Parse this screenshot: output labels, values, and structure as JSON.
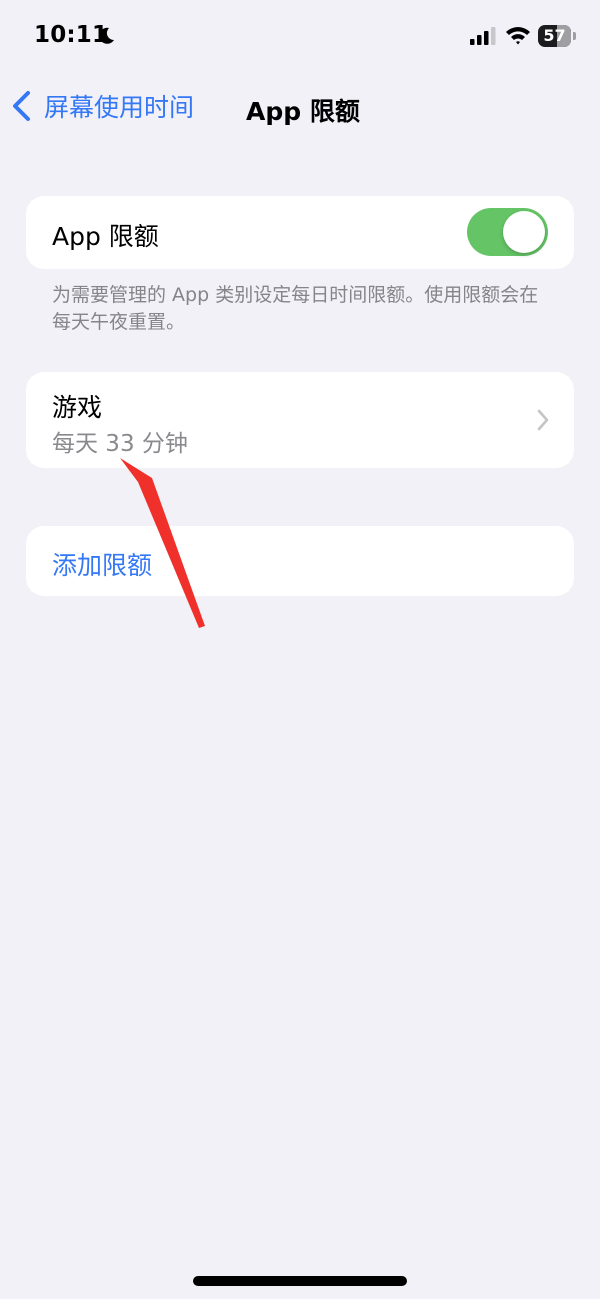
{
  "status_bar": {
    "time": "10:11",
    "battery_level": "57",
    "icons": [
      "moon-icon",
      "signal-icon",
      "wifi-icon",
      "battery-icon"
    ]
  },
  "nav": {
    "back_label": "屏幕使用时间",
    "title": "App 限额"
  },
  "toggle_row": {
    "label": "App 限额",
    "enabled": true
  },
  "footer_note": "为需要管理的 App 类别设定每日时间限额。使用限额会在每天午夜重置。",
  "limit_item": {
    "title": "游戏",
    "subtitle": "每天 33 分钟"
  },
  "add_limit": {
    "label": "添加限额"
  },
  "colors": {
    "accent": "#3478f6",
    "toggle_on": "#65c466",
    "background": "#f2f1f7",
    "annotation": "#f0302a"
  }
}
